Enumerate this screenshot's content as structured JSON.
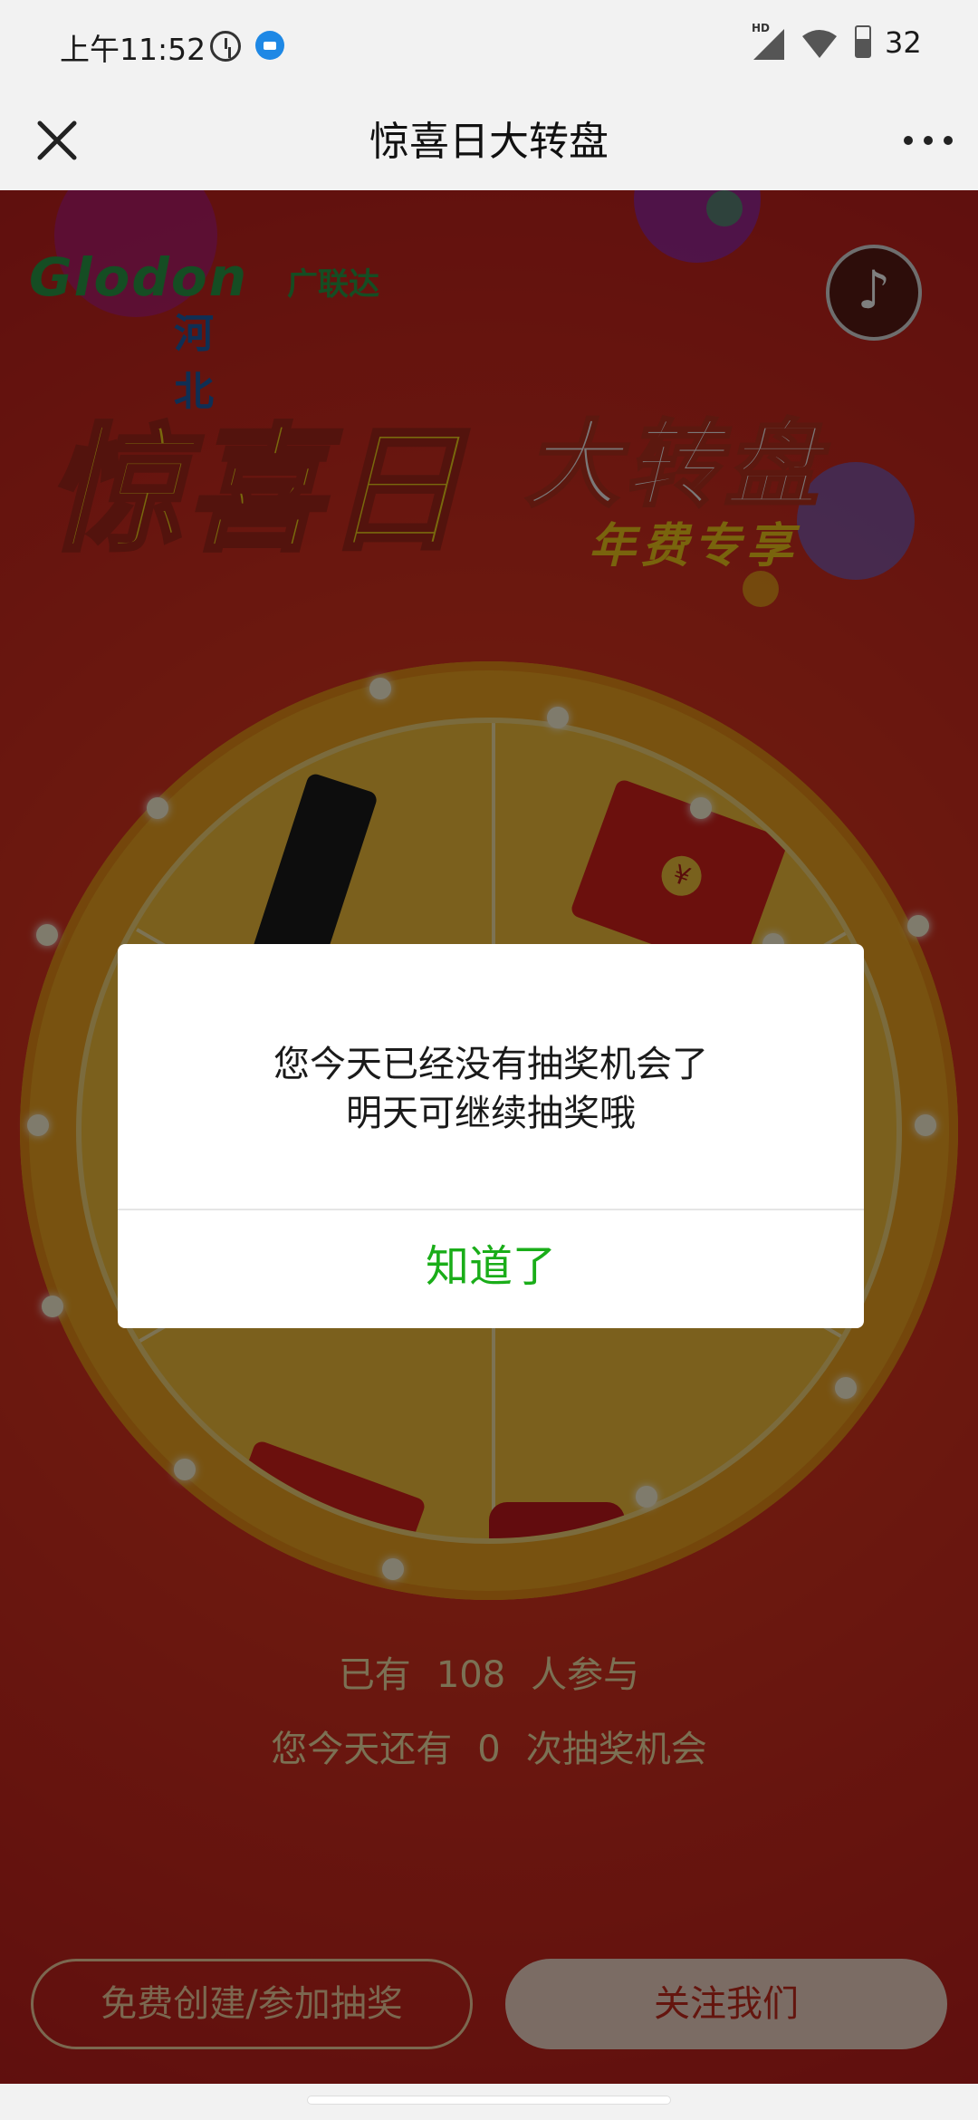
{
  "status_bar": {
    "time": "上午11:52",
    "network": "HD",
    "battery": "32"
  },
  "title_bar": {
    "title": "惊喜日大转盘"
  },
  "banner": {
    "logo_text": "Glodon",
    "logo_cn": "广联达",
    "logo_region": "河北",
    "headline_a": "惊喜日",
    "headline_b": "大转盘",
    "headline_sub": "年费专享"
  },
  "stats": {
    "participants_prefix": "已有",
    "participants_count": "108",
    "participants_suffix": "人参与",
    "chances_prefix": "您今天还有",
    "chances_count": "0",
    "chances_suffix": "次抽奖机会"
  },
  "buttons": {
    "create": "免费创建/参加抽奖",
    "follow": "关注我们"
  },
  "dialog": {
    "line1": "您今天已经没有抽奖机会了",
    "line2": "明天可继续抽奖哦",
    "confirm": "知道了"
  },
  "colors": {
    "accent_green": "#1aad19",
    "page_red": "#d9321f",
    "wheel_gold": "#f0a520"
  }
}
